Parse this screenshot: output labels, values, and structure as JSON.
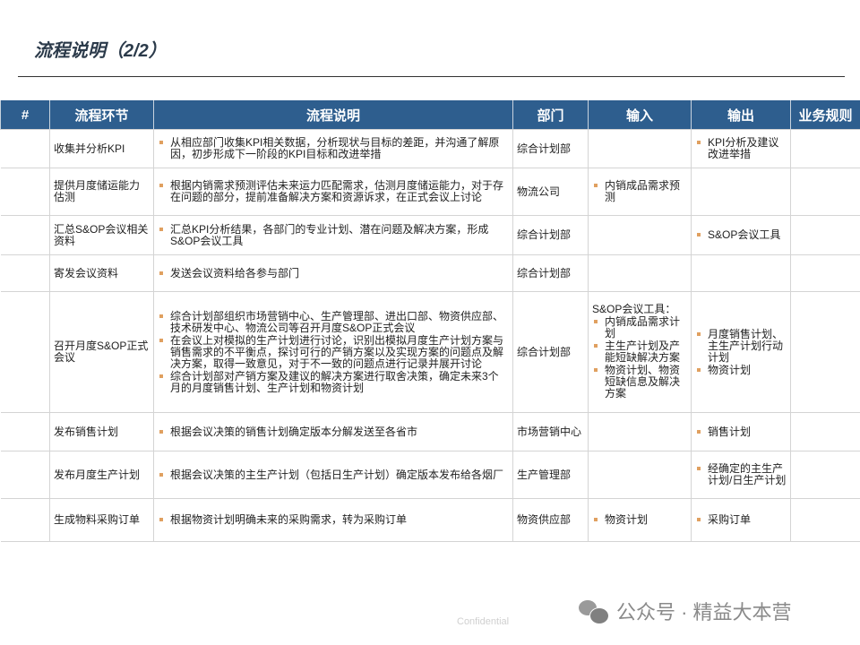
{
  "title": "流程说明（2/2）",
  "colors": {
    "header_bg": "#2e5e8e",
    "bullet": "#e0a060"
  },
  "table": {
    "headers": [
      "#",
      "流程环节",
      "流程说明",
      "部门",
      "输入",
      "输出",
      "业务规则"
    ],
    "rows": [
      {
        "step": "收集并分析KPI",
        "desc": [
          "从相应部门收集KPI相关数据，分析现状与目标的差距，并沟通了解原因，初步形成下一阶段的KPI目标和改进举措"
        ],
        "dept": "综合计划部",
        "input_intro": "",
        "input": [],
        "output": [
          "KPI分析及建议改进举措"
        ]
      },
      {
        "step": "提供月度储运能力估测",
        "desc": [
          "根据内销需求预测评估未来运力匹配需求，估测月度储运能力，对于存在问题的部分，提前准备解决方案和资源诉求，在正式会议上讨论"
        ],
        "dept": "物流公司",
        "input_intro": "",
        "input": [
          "内销成品需求预测"
        ],
        "output": []
      },
      {
        "step": "汇总S&OP会议相关资料",
        "desc": [
          "汇总KPI分析结果，各部门的专业计划、潜在问题及解决方案，形成S&OP会议工具"
        ],
        "dept": "综合计划部",
        "input_intro": "",
        "input": [],
        "output": [
          "S&OP会议工具"
        ]
      },
      {
        "step": "寄发会议资料",
        "desc": [
          "发送会议资料给各参与部门"
        ],
        "dept": "综合计划部",
        "input_intro": "",
        "input": [],
        "output": []
      },
      {
        "step": "召开月度S&OP正式会议",
        "desc": [
          "综合计划部组织市场营销中心、生产管理部、进出口部、物资供应部、技术研发中心、物流公司等召开月度S&OP正式会议",
          "在会议上对模拟的生产计划进行讨论，识别出模拟月度生产计划方案与销售需求的不平衡点，探讨可行的产销方案以及实现方案的问题点及解决方案，取得一致意见，对于不一致的问题点进行记录并展开讨论",
          "综合计划部对产销方案及建议的解决方案进行取舍决策，确定未来3个月的月度销售计划、生产计划和物资计划"
        ],
        "dept": "综合计划部",
        "input_intro": "S&OP会议工具：",
        "input": [
          "内销成品需求计划",
          "主生产计划及产能短缺解决方案",
          "物资计划、物资短缺信息及解决方案"
        ],
        "output": [
          "月度销售计划、主生产计划行动计划",
          "物资计划"
        ]
      },
      {
        "step": "发布销售计划",
        "desc": [
          "根据会议决策的销售计划确定版本分解发送至各省市"
        ],
        "dept": "市场营销中心",
        "input_intro": "",
        "input": [],
        "output": [
          "销售计划"
        ]
      },
      {
        "step": "发布月度生产计划",
        "desc": [
          "根据会议决策的主生产计划（包括日生产计划）确定版本发布给各烟厂"
        ],
        "dept": "生产管理部",
        "input_intro": "",
        "input": [],
        "output": [
          "经确定的主生产计划/日生产计划"
        ]
      },
      {
        "step": "生成物料采购订单",
        "desc": [
          "根据物资计划明确未来的采购需求，转为采购订单"
        ],
        "dept": "物资供应部",
        "input_intro": "",
        "input": [
          "物资计划"
        ],
        "output": [
          "采购订单"
        ]
      }
    ]
  },
  "footer": {
    "confidential": "Confidential",
    "watermark": "公众号 · 精益大本营"
  }
}
